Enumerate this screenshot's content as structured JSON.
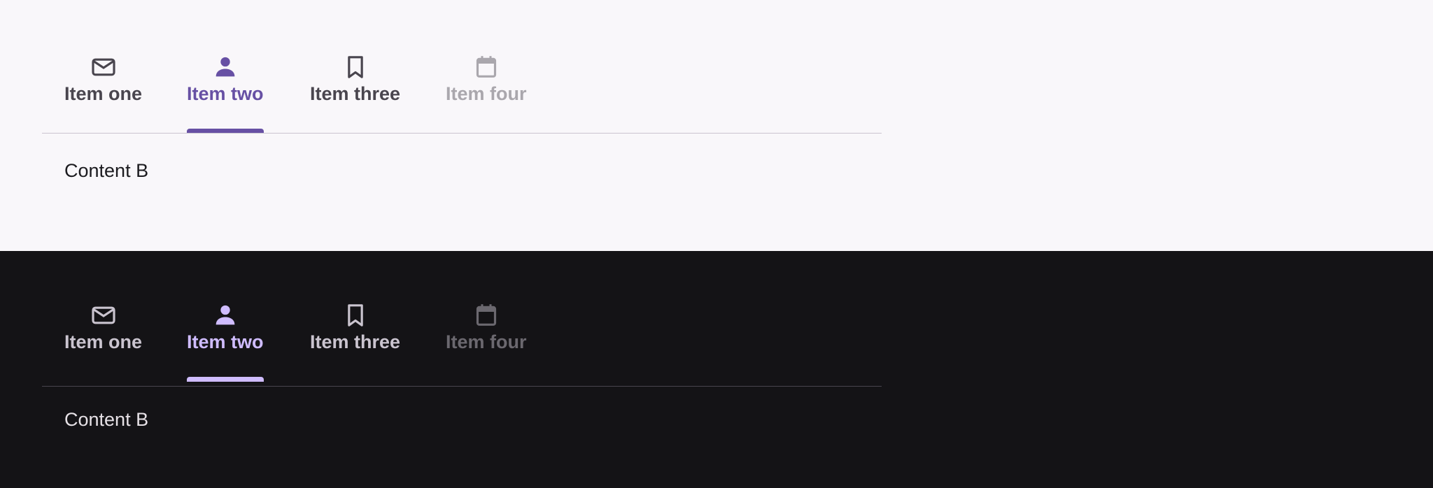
{
  "themes": {
    "light": {
      "tabs": [
        {
          "label": "Item one",
          "icon": "mail-icon",
          "state": "normal"
        },
        {
          "label": "Item two",
          "icon": "person-icon",
          "state": "selected"
        },
        {
          "label": "Item three",
          "icon": "bookmark-icon",
          "state": "normal"
        },
        {
          "label": "Item four",
          "icon": "calendar-icon",
          "state": "disabled"
        }
      ],
      "content": "Content B",
      "colors": {
        "background": "#f9f7fa",
        "accent": "#6750a4",
        "text": "#49454e",
        "disabled": "#aaa7ad"
      }
    },
    "dark": {
      "tabs": [
        {
          "label": "Item one",
          "icon": "mail-icon",
          "state": "normal"
        },
        {
          "label": "Item two",
          "icon": "person-icon",
          "state": "selected"
        },
        {
          "label": "Item three",
          "icon": "bookmark-icon",
          "state": "normal"
        },
        {
          "label": "Item four",
          "icon": "calendar-icon",
          "state": "disabled"
        }
      ],
      "content": "Content B",
      "colors": {
        "background": "#141316",
        "accent": "#cfbcff",
        "text": "#cac4cf",
        "disabled": "#6b686f"
      }
    }
  }
}
